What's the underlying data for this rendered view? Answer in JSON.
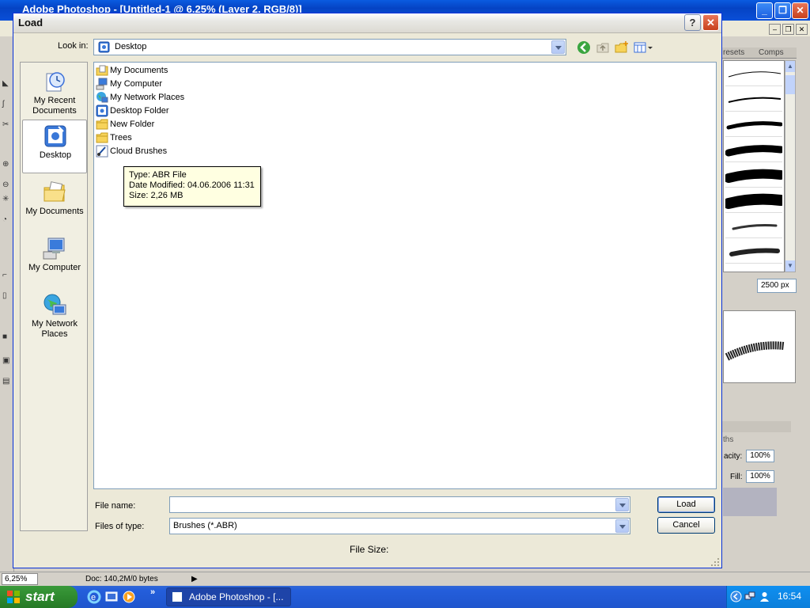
{
  "photoshop": {
    "title": "Adobe Photoshop - [Untitled-1 @ 6,25% (Layer 2, RGB/8)]",
    "panel_tabs": [
      "resets",
      "Comps"
    ],
    "brush_size": "2500 px",
    "layers_tab": "ths",
    "opacity_label": "acity:",
    "opacity_value": "100%",
    "fill_label": "Fill:",
    "fill_value": "100%",
    "status_zoom": "6,25%",
    "status_doc": "Doc: 140,2M/0 bytes"
  },
  "taskbar": {
    "start_label": "start",
    "task_label": "Adobe Photoshop - [...",
    "clock": "16:54",
    "more_glyph": "»"
  },
  "dialog": {
    "title": "Load",
    "help_glyph": "?",
    "close_glyph": "✕",
    "look_in_label": "Look in:",
    "look_in_value": "Desktop",
    "places": [
      {
        "label": "My Recent Documents",
        "icon": "recent-documents-icon"
      },
      {
        "label": "Desktop",
        "icon": "desktop-icon",
        "selected": true
      },
      {
        "label": "My Documents",
        "icon": "my-documents-icon"
      },
      {
        "label": "My Computer",
        "icon": "my-computer-icon"
      },
      {
        "label": "My Network Places",
        "icon": "network-places-icon"
      }
    ],
    "files": [
      {
        "name": "My Documents",
        "icon": "my-documents-icon"
      },
      {
        "name": "My Computer",
        "icon": "my-computer-icon"
      },
      {
        "name": "My Network Places",
        "icon": "network-places-icon"
      },
      {
        "name": "Desktop Folder",
        "icon": "desktop-folder-icon"
      },
      {
        "name": "New Folder",
        "icon": "folder-icon"
      },
      {
        "name": "Trees",
        "icon": "folder-icon"
      },
      {
        "name": "Cloud Brushes",
        "icon": "brush-file-icon"
      }
    ],
    "tooltip": {
      "type": "Type: ABR File",
      "modified": "Date Modified: 04.06.2006 11:31",
      "size": "Size: 2,26 MB"
    },
    "file_name_label": "File name:",
    "file_name_value": "",
    "files_of_type_label": "Files of type:",
    "files_of_type_value": "Brushes (*.ABR)",
    "file_size_label": "File Size:",
    "load_button": "Load",
    "cancel_button": "Cancel"
  },
  "colors": {
    "xp_blue": "#245edb",
    "start_green": "#2f8a2f",
    "dialog_face": "#ece9d8",
    "tooltip_bg": "#ffffe1"
  }
}
